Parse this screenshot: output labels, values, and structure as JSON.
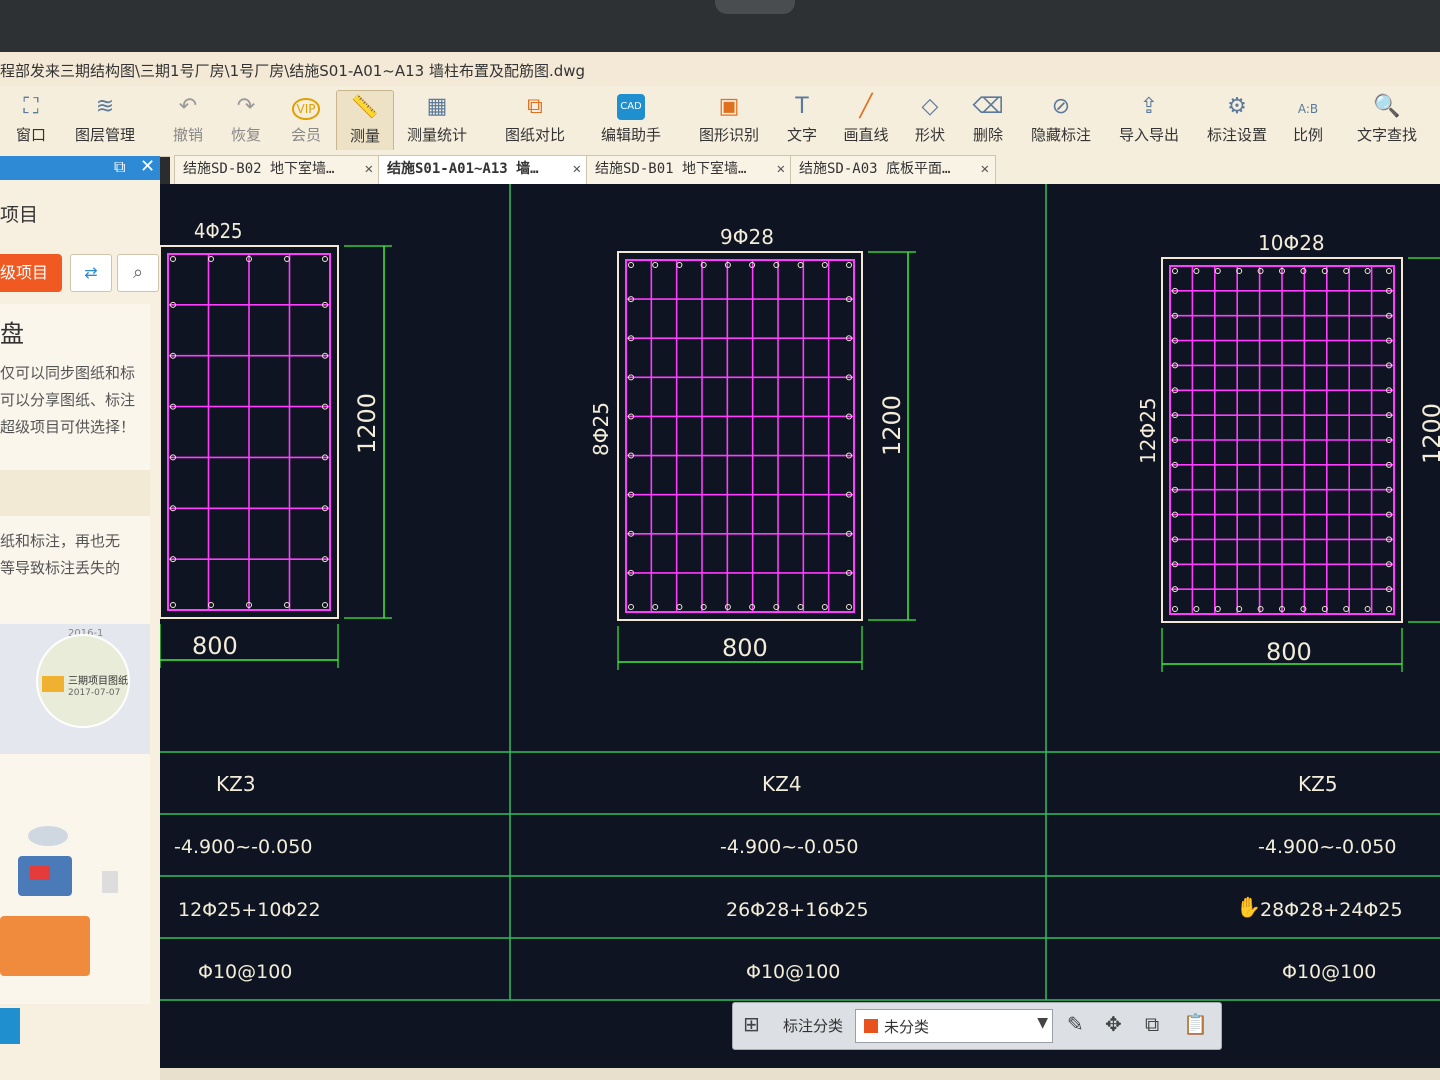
{
  "window": {
    "title": "程部发来三期结构图\\三期1号厂房\\1号厂房\\结施S01-A01~A13 墙柱布置及配筋图.dwg"
  },
  "toolbar": {
    "items": [
      {
        "label": "窗口",
        "icon": "window-icon"
      },
      {
        "label": "图层管理",
        "icon": "layers-icon"
      },
      {
        "label": "撤销",
        "icon": "undo-icon"
      },
      {
        "label": "恢复",
        "icon": "redo-icon"
      },
      {
        "label": "会员",
        "icon": "vip-icon"
      },
      {
        "label": "测量",
        "icon": "ruler-icon"
      },
      {
        "label": "测量统计",
        "icon": "measure-stats-icon"
      },
      {
        "label": "图纸对比",
        "icon": "compare-icon"
      },
      {
        "label": "编辑助手",
        "icon": "cad-edit-icon"
      },
      {
        "label": "图形识别",
        "icon": "shape-recognize-icon"
      },
      {
        "label": "文字",
        "icon": "text-icon"
      },
      {
        "label": "画直线",
        "icon": "line-icon"
      },
      {
        "label": "形状",
        "icon": "shape-icon"
      },
      {
        "label": "删除",
        "icon": "eraser-icon"
      },
      {
        "label": "隐藏标注",
        "icon": "hide-annotation-icon"
      },
      {
        "label": "导入导出",
        "icon": "import-export-icon"
      },
      {
        "label": "标注设置",
        "icon": "annotation-settings-icon"
      },
      {
        "label": "比例",
        "icon": "scale-icon"
      },
      {
        "label": "文字查找",
        "icon": "text-search-icon"
      }
    ],
    "vip_text": "VIP",
    "cad_text": "CAD",
    "scale_text": "A:B"
  },
  "sidebar": {
    "title": "项目",
    "super_button": "级项目",
    "panel_title": "盘",
    "desc1": [
      "仅可以同步图纸和标",
      "可以分享图纸、标注",
      "超级项目可供选择！"
    ],
    "desc2": [
      "纸和标注，再也无",
      "等导致标注丢失的"
    ],
    "card_name": "三期项目图纸",
    "card_date": "2017-07-07",
    "card_year": "2016-1"
  },
  "tabs": [
    {
      "label": "结施SD-B02 地下室墙…",
      "active": false
    },
    {
      "label": "结施S01-A01~A13 墙…",
      "active": true
    },
    {
      "label": "结施SD-B01 地下室墙…",
      "active": false
    },
    {
      "label": "结施SD-A03 底板平面…",
      "active": false
    }
  ],
  "drawing": {
    "columns": [
      {
        "name": "KZ3",
        "top_rebar": "4Φ25",
        "side_rebar": "",
        "width": "800",
        "height": "1200",
        "elevation": "-4.900~-0.050",
        "main_rebar": "12Φ25+10Φ22",
        "stirrup": "Φ10@100"
      },
      {
        "name": "KZ4",
        "top_rebar": "9Φ28",
        "side_rebar": "8Φ25",
        "width": "800",
        "height": "1200",
        "elevation": "-4.900~-0.050",
        "main_rebar": "26Φ28+16Φ25",
        "stirrup": "Φ10@100"
      },
      {
        "name": "KZ5",
        "top_rebar": "10Φ28",
        "side_rebar": "12Φ25",
        "width": "800",
        "height": "1200",
        "elevation": "-4.900~-0.050",
        "main_rebar": "28Φ28+24Φ25",
        "stirrup": "Φ10@100"
      }
    ],
    "colors": {
      "background": "#0e1422",
      "rebar": "#ff3cff",
      "outline": "#f2e8d4",
      "dimension": "#3df03d",
      "grid": "#2ec060",
      "text": "#f2ecd8"
    }
  },
  "annotation_bar": {
    "label": "标注分类",
    "selected": "未分类",
    "swatch_color": "#e8521c"
  }
}
